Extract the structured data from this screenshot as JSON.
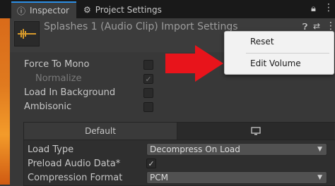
{
  "tabs": {
    "inspector": "Inspector",
    "project_settings": "Project Settings"
  },
  "header": {
    "title": "Splashes 1 (Audio Clip) Import Settings"
  },
  "properties": {
    "force_to_mono": "Force To Mono",
    "normalize": "Normalize",
    "load_in_background": "Load In Background",
    "ambisonic": "Ambisonic"
  },
  "platform_tabs": {
    "default": "Default"
  },
  "settings": {
    "load_type_label": "Load Type",
    "load_type_value": "Decompress On Load",
    "preload_label": "Preload Audio Data*",
    "compression_label": "Compression Format",
    "compression_value": "PCM"
  },
  "context_menu": {
    "reset": "Reset",
    "edit_volume": "Edit Volume"
  },
  "colors": {
    "accent_tab": "#2c8fe6",
    "arrow": "#e8141b"
  },
  "icons": [
    "inspector-icon",
    "gear-icon",
    "lock-icon",
    "kebab-menu-icon",
    "help-icon",
    "preset-icon",
    "monitor-icon",
    "audio-waveform-icon"
  ]
}
